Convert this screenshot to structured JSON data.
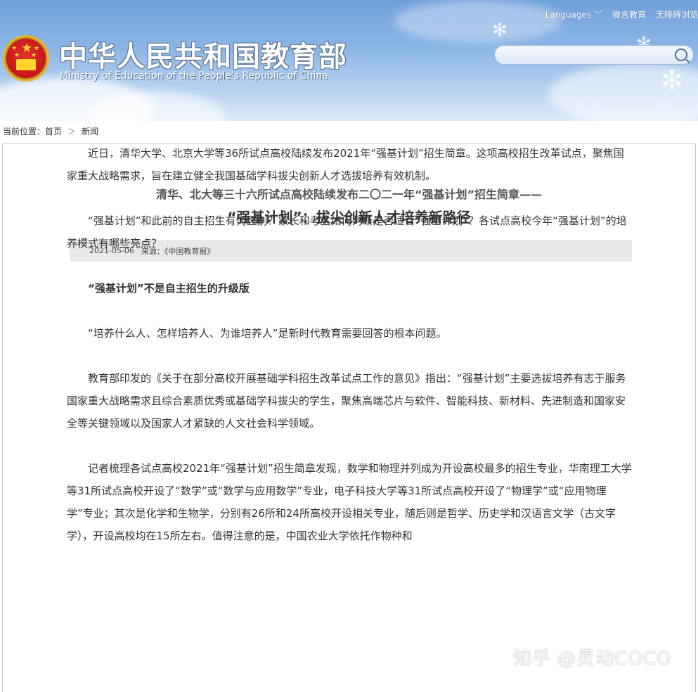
{
  "header": {
    "title_cn": "中华人民共和国教育部",
    "title_en": "Ministry of Education of the People's Republic of China",
    "links": [
      "Languages",
      "微言教育",
      "无障碍浏览"
    ],
    "search_placeholder": ""
  },
  "breadcrumb": {
    "label": "当前位置：",
    "items": [
      "首页",
      "新闻"
    ]
  },
  "article": {
    "headline1": "清华、北大等三十六所试点高校陆续发布二〇二一年“强基计划”招生简章——",
    "headline2": "“强基计划”：拔尖创新人才培养新路径",
    "date": "2021-05-06",
    "source": "来源：《中国教育报》",
    "paragraphs": [
      "近日，清华大学、北京大学等36所试点高校陆续发布2021年“强基计划”招生简章。这项高校招生改革试点，聚焦国家重大战略需求，旨在建立健全我国基础学科拔尖创新人才选拔培养有效机制。",
      "“强基计划”和此前的自主招生有何区别？家长和考生如何判断是否适合“强基计划”？各试点高校今年“强基计划”的培养模式有哪些亮点？",
      "“强基计划”不是自主招生的升级版",
      "“培养什么人、怎样培养人、为谁培养人”是新时代教育需要回答的根本问题。",
      "教育部印发的《关于在部分高校开展基础学科招生改革试点工作的意见》指出：“强基计划”主要选拔培养有志于服务国家重大战略需求且综合素质优秀或基础学科拔尖的学生，聚焦高端芯片与软件、智能科技、新材料、先进制造和国家安全等关键领域以及国家人才紧缺的人文社会科学领域。",
      "记者梳理各试点高校2021年“强基计划”招生简章发现，数学和物理并列成为开设高校最多的招生专业，华南理工大学等31所试点高校开设了“数学”或“数学与应用数学”专业，电子科技大学等31所试点高校开设了“物理学”或“应用物理学”专业；其次是化学和生物学，分别有26所和24所高校开设相关专业，随后则是哲学、历史学和汉语言文学（古文字学），开设高校均在15所左右。值得注意的是，中国农业大学依托作物种和"
    ]
  },
  "watermark": "知乎 @灵动COCO"
}
